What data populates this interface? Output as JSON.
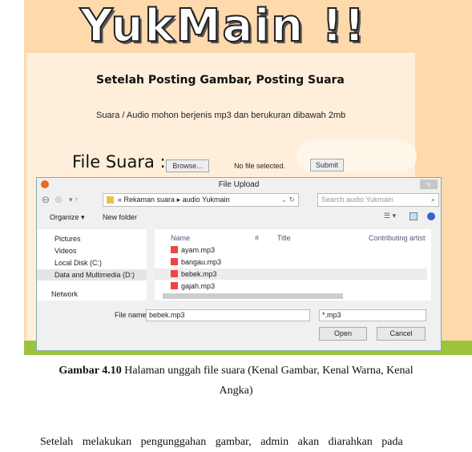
{
  "site": {
    "logo": "YukMain !!",
    "heading": "Setelah Posting Gambar, Posting Suara",
    "note": "Suara / Audio mohon berjenis mp3 dan berukuran dibawah 2mb",
    "file_label": "File Suara :",
    "browse": "Browse...",
    "no_file": "No file selected.",
    "submit": "Submit"
  },
  "dialog": {
    "title": "File Upload",
    "close": "×",
    "breadcrumb": [
      "«",
      "Rekaman suara",
      "▸",
      "audio Yukmain"
    ],
    "search_placeholder": "Search audio Yukmain",
    "organize": "Organize ▾",
    "new_folder": "New folder",
    "nav": [
      "Pictures",
      "Videos",
      "Local Disk (C:)",
      "Data and Multimedia (D:)",
      "Network"
    ],
    "columns": [
      "Name",
      "#",
      "Title",
      "Contributing artist"
    ],
    "files": [
      "ayam.mp3",
      "bangau.mp3",
      "bebek.mp3",
      "gajah.mp3"
    ],
    "filename_label": "File name:",
    "filename": "bebek.mp3",
    "filetype": "*.mp3",
    "open": "Open",
    "cancel": "Cancel"
  },
  "caption": {
    "bold": "Gambar 4.10",
    "text": " Halaman unggah file suara (Kenal Gambar, Kenal Warna, Kenal",
    "line2": "Angka)"
  },
  "paragraph": "Setelah melakukan pengunggahan gambar, admin akan diarahkan pada"
}
